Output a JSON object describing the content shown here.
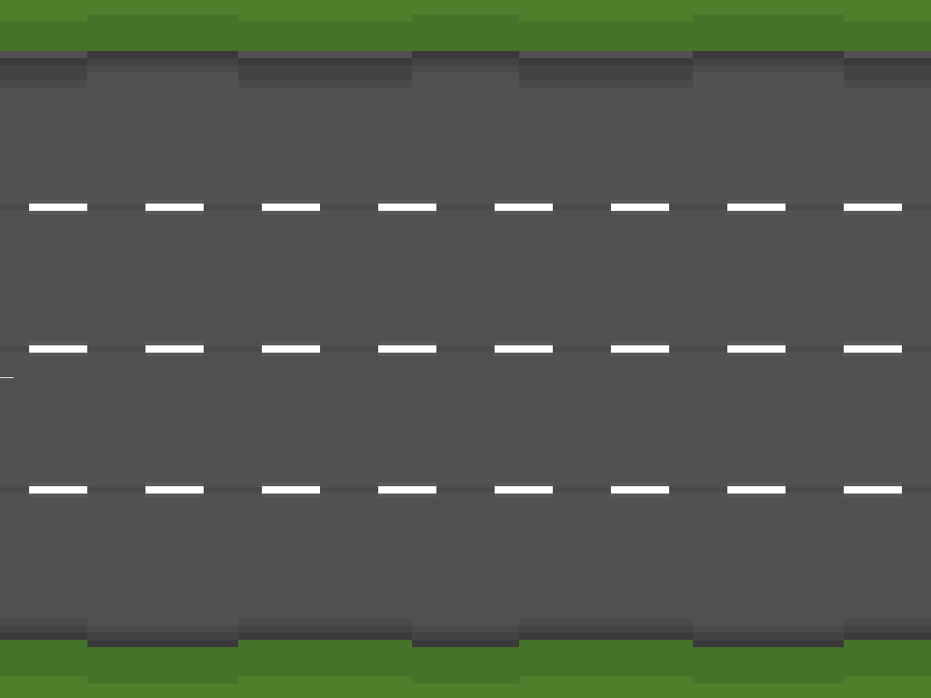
{
  "scene": {
    "type": "top-down road",
    "lanes": 4,
    "lane_divider_rows": 3,
    "dashes_per_row": 8
  },
  "colors": {
    "grass_light": "#4f7f2a",
    "grass_dark": "#46732a",
    "curb_dark": "#3a3a3a",
    "curb_mid": "#434343",
    "asphalt": "#515151",
    "asphalt_seam": "#4a4a4a",
    "lane_marking": "#ffffff",
    "marking_shadow": "#5a5a5a"
  }
}
